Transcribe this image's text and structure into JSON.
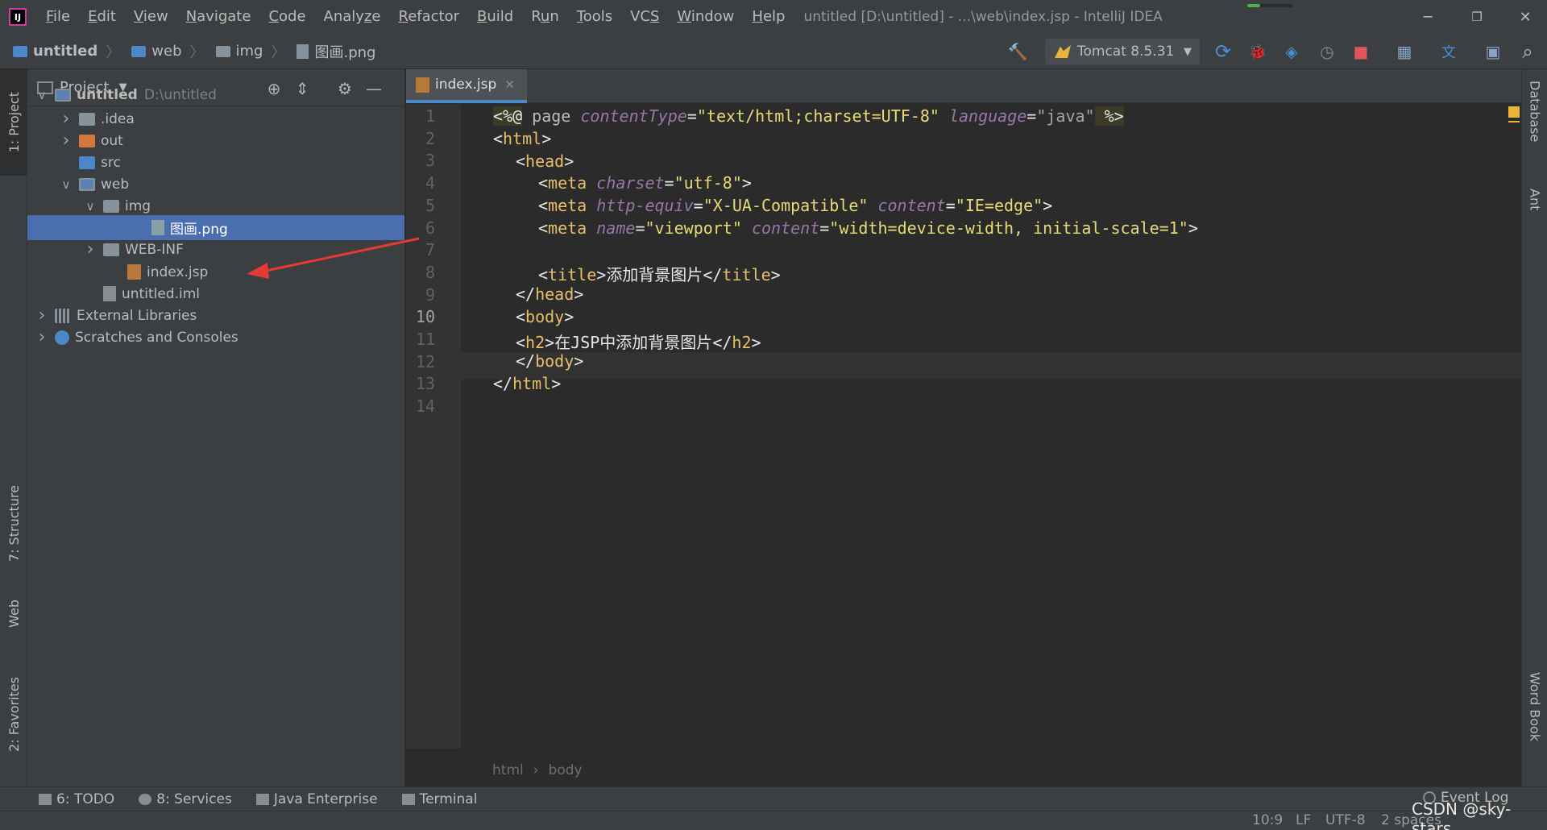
{
  "titlebar": {
    "logo_text": "IJ",
    "menu": [
      {
        "mn": "F",
        "rest": "ile"
      },
      {
        "mn": "E",
        "rest": "dit"
      },
      {
        "mn": "V",
        "rest": "iew"
      },
      {
        "mn": "N",
        "rest": "avigate"
      },
      {
        "mn": "C",
        "rest": "ode"
      },
      {
        "pre": "Analy",
        "mn": "z",
        "rest": "e"
      },
      {
        "mn": "R",
        "rest": "efactor"
      },
      {
        "mn": "B",
        "rest": "uild"
      },
      {
        "pre": "R",
        "mn": "u",
        "rest": "n"
      },
      {
        "mn": "T",
        "rest": "ools"
      },
      {
        "pre": "VC",
        "mn": "S",
        "rest": ""
      },
      {
        "mn": "W",
        "rest": "indow"
      },
      {
        "mn": "H",
        "rest": "elp"
      }
    ],
    "window_title": "untitled [D:\\untitled] - ...\\web\\index.jsp - IntelliJ IDEA",
    "progress": 0.28,
    "buttons": {
      "minimize": "─",
      "restore": "❐",
      "close": "✕"
    }
  },
  "navbar": {
    "breadcrumbs": [
      "untitled",
      "web",
      "img",
      "图画.png"
    ],
    "separator": "〉",
    "run_config": "Tomcat 8.5.31",
    "dropdown_glyph": "▼",
    "icons": {
      "build": "🔨",
      "rerun": "⟳",
      "debug": "🐞",
      "coverage": "◈",
      "profile": "◷",
      "stop": "■",
      "project_structure": "▦",
      "translate": "文",
      "terminal": "▣",
      "search": "⌕"
    }
  },
  "left_strip": {
    "project": "1: Project",
    "structure": "7: Structure",
    "web": "Web",
    "favorites": "2: Favorites"
  },
  "right_strip": {
    "database": "Database",
    "ant": "Ant",
    "wordbook": "Word Book"
  },
  "project_panel": {
    "title": "Project",
    "dropdown_glyph": "▼",
    "icons": {
      "locate": "⊕",
      "collapse": "⇕",
      "settings": "⚙",
      "hide": "—"
    },
    "tree": [
      {
        "label": "untitled",
        "path": "D:\\untitled",
        "arrow": "v",
        "icon": "module",
        "indent": 0,
        "bold": true
      },
      {
        "label": ".idea",
        "arrow": ">",
        "icon": "folder",
        "indent": 1
      },
      {
        "label": "out",
        "arrow": ">",
        "icon": "folder-orange",
        "indent": 1
      },
      {
        "label": "src",
        "arrow": "",
        "icon": "folder-blue",
        "indent": 1
      },
      {
        "label": "web",
        "arrow": "v",
        "icon": "module",
        "indent": 1
      },
      {
        "label": "img",
        "arrow": "v",
        "icon": "folder",
        "indent": 2
      },
      {
        "label": "图画.png",
        "arrow": "",
        "icon": "png",
        "indent": 4,
        "selected": true
      },
      {
        "label": "WEB-INF",
        "arrow": ">",
        "icon": "folder",
        "indent": 2
      },
      {
        "label": "index.jsp",
        "arrow": "",
        "icon": "jsp",
        "indent": 3
      },
      {
        "label": "untitled.iml",
        "arrow": "",
        "icon": "iml",
        "indent": 2
      },
      {
        "label": "External Libraries",
        "arrow": ">",
        "icon": "libs",
        "indent": 0
      },
      {
        "label": "Scratches and Consoles",
        "arrow": ">",
        "icon": "scratch",
        "indent": 0
      }
    ]
  },
  "editor": {
    "tab": {
      "label": "index.jsp",
      "close": "✕"
    },
    "line_numbers": [
      "1",
      "2",
      "3",
      "4",
      "5",
      "6",
      "7",
      "8",
      "9",
      "10",
      "11",
      "12",
      "13",
      "14"
    ],
    "current_line": "10",
    "lines": {
      "l1": {
        "a": "<%@",
        "b": " page ",
        "c": "contentType",
        "d": "=",
        "e": "\"text/html;charset=UTF-8\"",
        "f": " ",
        "g": "language",
        "h": "=",
        "i": "\"java\"",
        "j": " %>"
      },
      "l2": {
        "o": "<",
        "t": "html",
        "c": ">"
      },
      "l3": {
        "o": "<",
        "t": "head",
        "c": ">"
      },
      "l4": {
        "o": "<",
        "t": "meta",
        "a": " charset",
        "eq": "=",
        "v": "\"utf-8\"",
        "c": ">"
      },
      "l5": {
        "o": "<",
        "t": "meta",
        "a": " http-equiv",
        "eq": "=",
        "v": "\"X-UA-Compatible\"",
        "a2": " content",
        "eq2": "=",
        "v2": "\"IE=edge\"",
        "c": ">"
      },
      "l6": {
        "o": "<",
        "t": "meta",
        "a": " name",
        "eq": "=",
        "v": "\"viewport\"",
        "a2": " content",
        "eq2": "=",
        "v2": "\"width=device-width, initial-scale=1\"",
        "c": ">"
      },
      "l8": {
        "o": "<",
        "t": "title",
        "c": ">",
        "text": "添加背景图片",
        "o2": "</",
        "t2": "title",
        "c2": ">"
      },
      "l9": {
        "o": "</",
        "t": "head",
        "c": ">"
      },
      "l10": {
        "o": "<",
        "t": "body",
        "c": ">"
      },
      "l11": {
        "o": "<",
        "t": "h2",
        "c": ">",
        "text": "在JSP中添加背景图片",
        "o2": "</",
        "t2": "h2",
        "c2": ">"
      },
      "l12": {
        "o": "</",
        "t": "body",
        "c": ">"
      },
      "l13": {
        "o": "</",
        "t": "html",
        "c": ">"
      }
    },
    "breadcrumb": [
      "html",
      "body"
    ],
    "breadcrumb_sep": "›"
  },
  "bottom_tools": [
    {
      "label": "6: TODO"
    },
    {
      "label": "8: Services"
    },
    {
      "label": "Java Enterprise"
    },
    {
      "label": "Terminal"
    }
  ],
  "event_log": "Event Log",
  "statusbar": {
    "position": "10:9",
    "line_sep": "LF",
    "encoding": "UTF-8",
    "indent": "2 spaces"
  },
  "watermark": "CSDN @sky-stars",
  "colors": {
    "accent": "#4a88c7",
    "selection": "#4b6eaf",
    "annotation": "#e53935"
  }
}
